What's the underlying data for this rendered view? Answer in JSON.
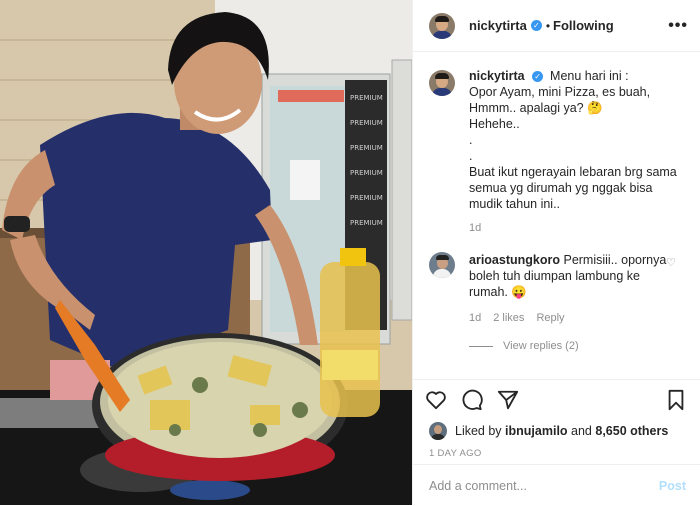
{
  "header": {
    "username": "nickytirta",
    "verified_mark": "✓",
    "separator": "•",
    "follow_state": "Following",
    "more_label": "•••"
  },
  "caption": {
    "username": "nickytirta",
    "verified_mark": "✓",
    "lines": [
      "Menu hari ini :",
      "Opor Ayam, mini Pizza, es buah,",
      "Hmmm.. apalagi ya? 🤔",
      "Hehehe..",
      ".",
      ".",
      "Buat ikut ngerayain lebaran brg sama",
      "semua yg dirumah yg nggak bisa",
      "mudik tahun ini.."
    ],
    "time": "1d"
  },
  "comment": {
    "username": "arioastungkoro",
    "text": "Permisiii.. opornya boleh tuh diumpan lambung ke rumah. 😛",
    "time": "1d",
    "likes": "2 likes",
    "reply_label": "Reply",
    "view_replies": "View replies (2)",
    "heart_icon": "♡"
  },
  "actions": {
    "icons": [
      "heart-icon",
      "comment-icon",
      "share-icon",
      "bookmark-icon"
    ]
  },
  "likes": {
    "prefix": "Liked by",
    "user": "ibnujamilo",
    "and": "and",
    "count": "8,650 others"
  },
  "timestamp": "1 DAY AGO",
  "add_comment": {
    "placeholder": "Add a comment...",
    "post_label": "Post"
  },
  "colors": {
    "verified": "#3897f0",
    "post_disabled": "#b2dffc",
    "muted": "#8e8e8e"
  }
}
